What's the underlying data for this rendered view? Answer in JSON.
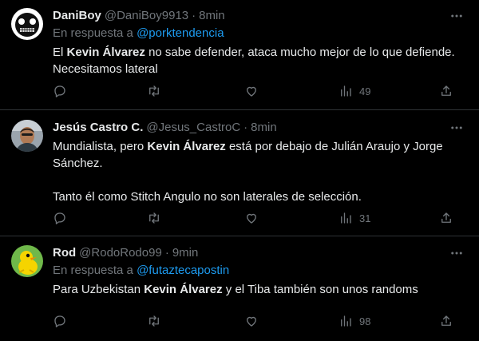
{
  "tweets": [
    {
      "name": "DaniBoy",
      "handle": "@DaniBoy9913",
      "dot": "·",
      "time": "8min",
      "reply_prefix": "En respuesta a ",
      "reply_to": "@porktendencia",
      "text_parts": [
        "El ",
        "Kevin Álvarez",
        " no sabe defender, ataca mucho mejor de lo que defiende. Necesitamos lateral"
      ],
      "views": "49"
    },
    {
      "name": "Jesús Castro C.",
      "handle": "@Jesus_CastroC",
      "dot": "·",
      "time": "8min",
      "text_parts": [
        "Mundialista, pero ",
        "Kevin Álvarez",
        " está por debajo de Julián Araujo y Jorge Sánchez.\n\nTanto él como Stitch Angulo no son laterales de selección."
      ],
      "views": "31"
    },
    {
      "name": "Rod",
      "handle": "@RodoRodo99",
      "dot": "·",
      "time": "9min",
      "reply_prefix": "En respuesta a ",
      "reply_to": "@futaztecapostin",
      "text_parts": [
        "Para Uzbekistan ",
        "Kevin Álvarez",
        " y el Tiba también son unos randoms"
      ],
      "views": "98"
    }
  ],
  "icons": {
    "reply": "reply-icon",
    "retweet": "retweet-icon",
    "like": "like-icon",
    "views": "views-icon",
    "share": "share-icon",
    "more": "more-icon"
  },
  "colors": {
    "background": "#000000",
    "text": "#e7e9ea",
    "secondary": "#71767b",
    "link": "#1d9bf0",
    "divider": "#2f3336"
  }
}
